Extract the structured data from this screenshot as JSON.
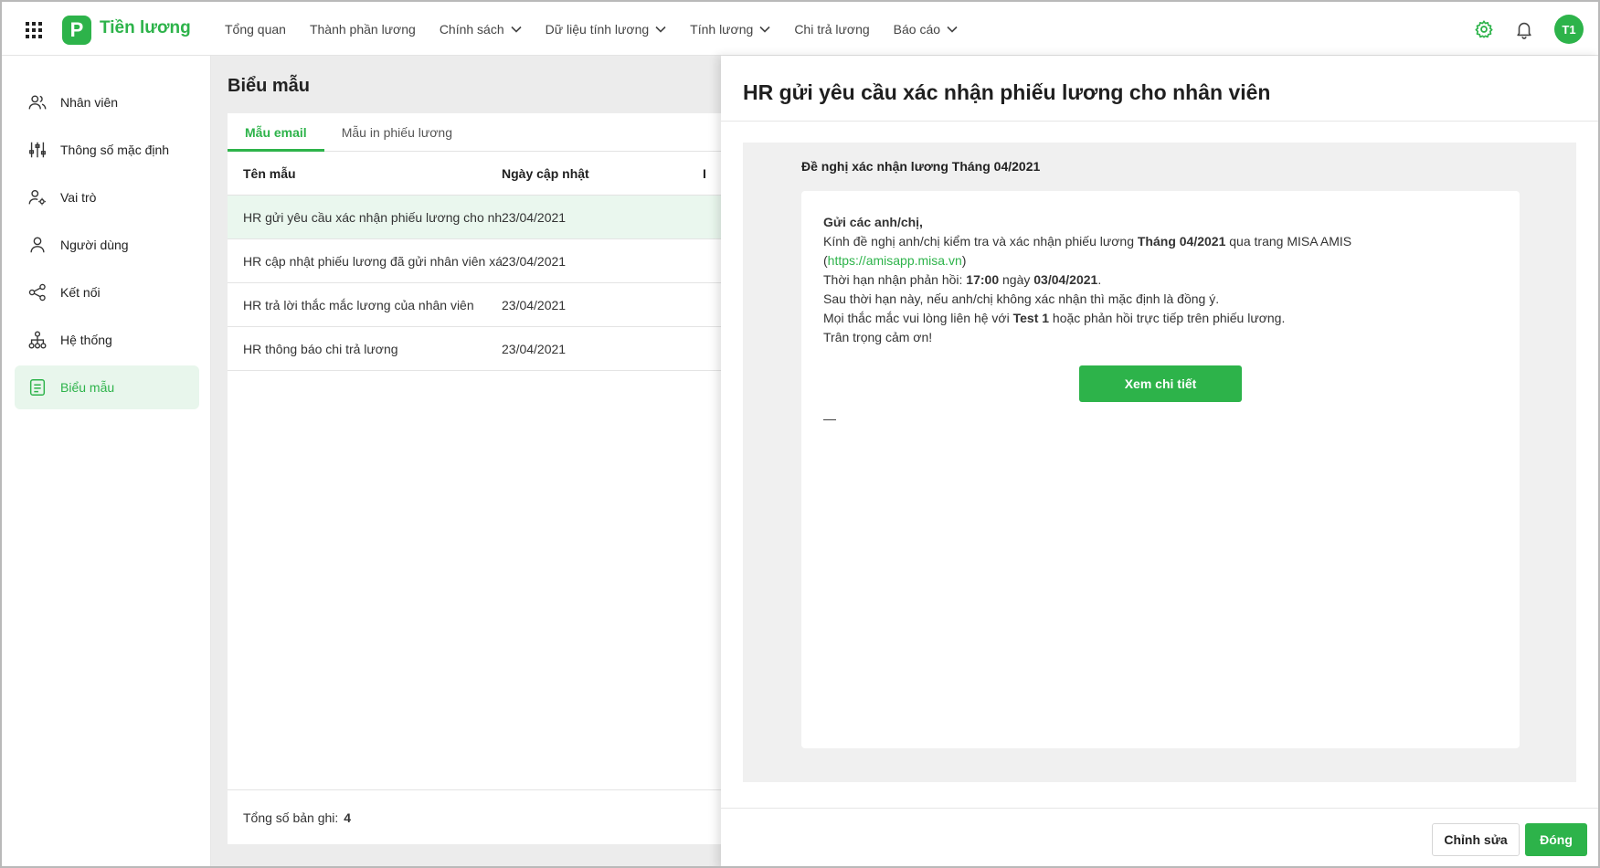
{
  "app": {
    "logo_letter": "P",
    "name": "Tiền lương",
    "avatar": "T1",
    "accent": "#2db34a"
  },
  "nav": {
    "items": [
      {
        "label": "Tổng quan",
        "dropdown": false
      },
      {
        "label": "Thành phần lương",
        "dropdown": false
      },
      {
        "label": "Chính sách",
        "dropdown": true
      },
      {
        "label": "Dữ liệu tính lương",
        "dropdown": true
      },
      {
        "label": "Tính lương",
        "dropdown": true
      },
      {
        "label": "Chi trả lương",
        "dropdown": false
      },
      {
        "label": "Báo cáo",
        "dropdown": true
      }
    ]
  },
  "sidebar": {
    "items": [
      {
        "label": "Nhân viên",
        "icon": "users-icon"
      },
      {
        "label": "Thông số mặc định",
        "icon": "sliders-icon"
      },
      {
        "label": "Vai trò",
        "icon": "user-role-icon"
      },
      {
        "label": "Người dùng",
        "icon": "user-icon"
      },
      {
        "label": "Kết nối",
        "icon": "share-icon"
      },
      {
        "label": "Hệ thống",
        "icon": "hierarchy-icon"
      },
      {
        "label": "Biểu mẫu",
        "icon": "form-icon",
        "active": true
      }
    ]
  },
  "main": {
    "title": "Biểu mẫu",
    "tabs": [
      {
        "label": "Mẫu email",
        "active": true
      },
      {
        "label": "Mẫu in phiếu lương",
        "active": false
      }
    ],
    "columns": [
      "Tên mẫu",
      "Ngày cập nhật",
      "I"
    ],
    "rows": [
      {
        "name": "HR gửi yêu cầu xác nhận phiếu lương cho nhân viên",
        "date": "23/04/2021",
        "selected": true
      },
      {
        "name": "HR cập nhật phiếu lương đã gửi nhân viên xác nhận",
        "date": "23/04/2021",
        "selected": false
      },
      {
        "name": "HR trả lời thắc mắc lương của nhân viên",
        "date": "23/04/2021",
        "selected": false
      },
      {
        "name": "HR thông báo chi trả lương",
        "date": "23/04/2021",
        "selected": false
      }
    ],
    "footer_label": "Tổng số bản ghi:",
    "footer_count": "4"
  },
  "panel": {
    "title": "HR gửi yêu cầu xác nhận phiếu lương cho nhân viên",
    "subject": "Đề nghị xác nhận lương Tháng 04/2021",
    "mail": {
      "greeting": "Gửi các anh/chị,",
      "line1_a": "Kính đề nghị anh/chị kiểm tra và xác nhận phiếu lương ",
      "line1_b": "Tháng 04/2021",
      "line1_c": " qua trang MISA AMIS",
      "link_open": "(",
      "link": "https://amisapp.misa.vn",
      "link_close": ")",
      "line2_a": "Thời hạn nhận phản hồi: ",
      "line2_b": "17:00",
      "line2_c": " ngày ",
      "line2_d": "03/04/2021",
      "line2_e": ".",
      "line3": "Sau thời hạn này, nếu anh/chị không xác nhận thì mặc định là đồng ý.",
      "line4_a": "Mọi thắc mắc vui lòng liên hệ với ",
      "line4_b": "Test 1",
      "line4_c": " hoặc phản hồi trực tiếp trên phiếu lương.",
      "line5": "Trân trọng cảm ơn!",
      "button": "Xem chi tiết",
      "signature": "—"
    },
    "edit_button": "Chỉnh sửa",
    "close_button": "Đóng"
  }
}
